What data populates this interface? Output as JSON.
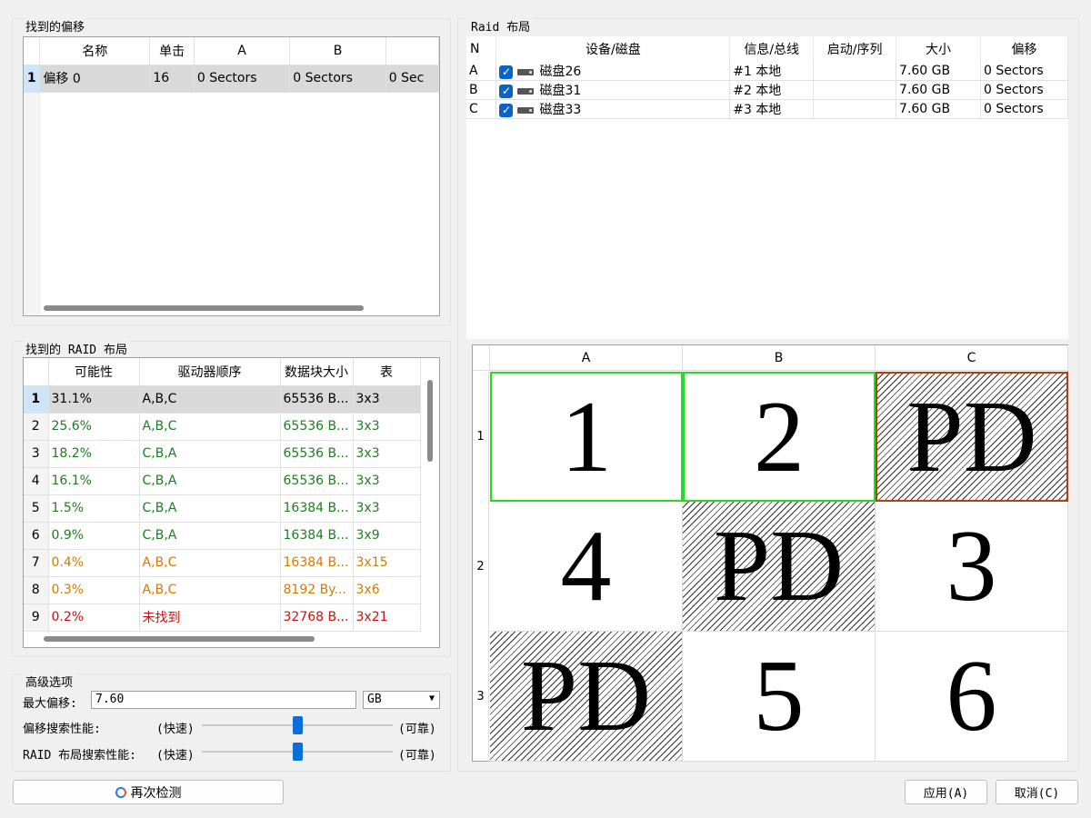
{
  "found_offsets": {
    "title": "找到的偏移",
    "columns": [
      "名称",
      "单击",
      "A",
      "B",
      ""
    ],
    "rows": [
      {
        "n": "1",
        "name": "偏移 0",
        "hits": "16",
        "a": "0 Sectors",
        "b": "0 Sectors",
        "c": "0 Sec"
      }
    ]
  },
  "found_layouts": {
    "title": "找到的 RAID 布局",
    "columns": [
      "可能性",
      "驱动器顺序",
      "数据块大小",
      "表"
    ],
    "rows": [
      {
        "n": "1",
        "prob": "31.1%",
        "order": "A,B,C",
        "block": "65536 B...",
        "table": "3x3",
        "color": "black"
      },
      {
        "n": "2",
        "prob": "25.6%",
        "order": "A,B,C",
        "block": "65536 B...",
        "table": "3x3",
        "color": "green"
      },
      {
        "n": "3",
        "prob": "18.2%",
        "order": "C,B,A",
        "block": "65536 B...",
        "table": "3x3",
        "color": "green"
      },
      {
        "n": "4",
        "prob": "16.1%",
        "order": "C,B,A",
        "block": "65536 B...",
        "table": "3x3",
        "color": "green"
      },
      {
        "n": "5",
        "prob": "1.5%",
        "order": "C,B,A",
        "block": "16384 B...",
        "table": "3x3",
        "color": "green"
      },
      {
        "n": "6",
        "prob": "0.9%",
        "order": "C,B,A",
        "block": "16384 B...",
        "table": "3x9",
        "color": "green"
      },
      {
        "n": "7",
        "prob": "0.4%",
        "order": "A,B,C",
        "block": "16384 B...",
        "table": "3x15",
        "color": "orange"
      },
      {
        "n": "8",
        "prob": "0.3%",
        "order": "A,B,C",
        "block": "8192 By...",
        "table": "3x6",
        "color": "orange"
      },
      {
        "n": "9",
        "prob": "0.2%",
        "order": "未找到",
        "block": "32768 B...",
        "table": "3x21",
        "color": "red"
      }
    ]
  },
  "advanced": {
    "title": "高级选项",
    "max_offset_label": "最大偏移:",
    "max_offset_value": "7.60",
    "unit": "GB",
    "offset_perf_label": "偏移搜索性能:",
    "layout_perf_label": "RAID 布局搜索性能:",
    "fast": "(快速)",
    "reliable": "(可靠)",
    "offset_perf_level": 0.5,
    "layout_perf_level": 0.5
  },
  "raid_layout": {
    "title": "Raid 布局",
    "columns": [
      "N",
      "设备/磁盘",
      "信息/总线",
      "启动/序列",
      "大小",
      "偏移"
    ],
    "disks": [
      {
        "n": "A",
        "name": "磁盘26",
        "info": "#1 本地",
        "seq": "",
        "size": "7.60 GB",
        "offset": "0 Sectors"
      },
      {
        "n": "B",
        "name": "磁盘31",
        "info": "#2 本地",
        "seq": "",
        "size": "7.60 GB",
        "offset": "0 Sectors"
      },
      {
        "n": "C",
        "name": "磁盘33",
        "info": "#3 本地",
        "seq": "",
        "size": "7.60 GB",
        "offset": "0 Sectors"
      }
    ],
    "grid": {
      "columns": [
        "A",
        "B",
        "C"
      ],
      "rows": [
        "1",
        "2",
        "3"
      ],
      "cells": [
        [
          "1",
          "2",
          "PD"
        ],
        [
          "4",
          "PD",
          "3"
        ],
        [
          "PD",
          "5",
          "6"
        ]
      ]
    }
  },
  "buttons": {
    "redetect": "再次检测",
    "apply": "应用(A)",
    "cancel": "取消(C)"
  }
}
